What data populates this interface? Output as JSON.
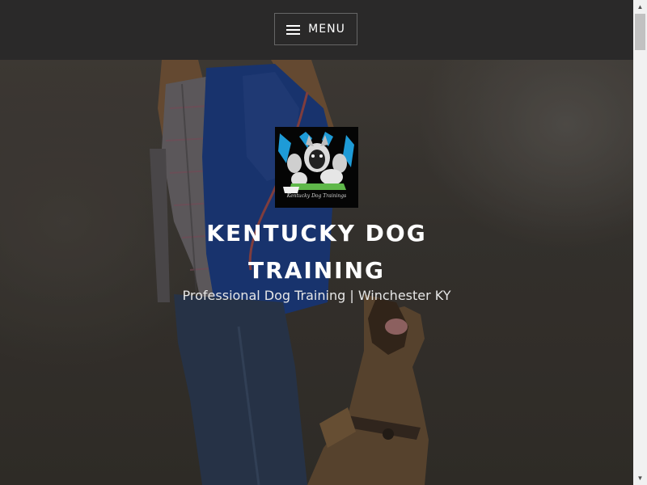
{
  "header": {
    "menu_label": "MENU",
    "menu_icon": "hamburger-icon"
  },
  "hero": {
    "logo_name": "logo",
    "logo_caption": "Kentucky Dog Trainings",
    "site_title": "KENTUCKY DOG TRAINING",
    "tagline": "Professional Dog Training | Winchester KY"
  },
  "scrollbar": {
    "up_icon": "arrow-up-icon",
    "down_icon": "arrow-down-icon"
  },
  "colors": {
    "header_bg": "#2a2929",
    "menu_border": "#666666",
    "title_text": "#ffffff",
    "logo_bg": "#050505",
    "logo_accent": "#1e9bd7"
  }
}
